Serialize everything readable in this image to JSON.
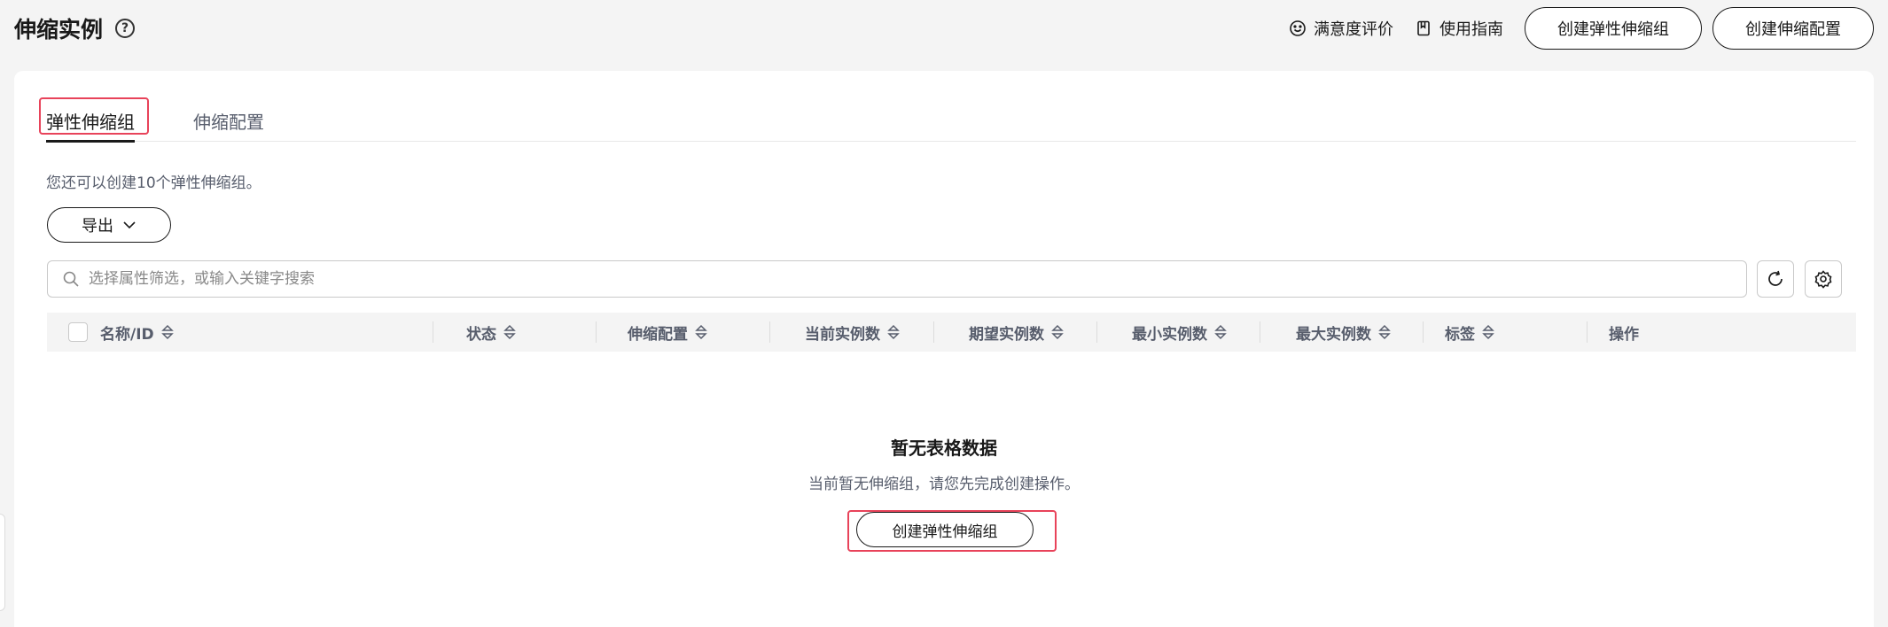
{
  "header": {
    "title": "伸缩实例",
    "help_icon": "question-circle-icon",
    "satisfaction_label": "满意度评价",
    "guide_label": "使用指南",
    "create_group_label": "创建弹性伸缩组",
    "create_config_label": "创建伸缩配置"
  },
  "tabs": [
    {
      "label": "弹性伸缩组",
      "active": true
    },
    {
      "label": "伸缩配置",
      "active": false
    }
  ],
  "quota_text": "您还可以创建10个弹性伸缩组。",
  "export_label": "导出",
  "search": {
    "placeholder": "选择属性筛选，或输入关键字搜索"
  },
  "table": {
    "columns": [
      "名称/ID",
      "状态",
      "伸缩配置",
      "当前实例数",
      "期望实例数",
      "最小实例数",
      "最大实例数",
      "标签",
      "操作"
    ]
  },
  "empty": {
    "title": "暂无表格数据",
    "description": "当前暂无伸缩组，请您先完成创建操作。",
    "button_label": "创建弹性伸缩组"
  },
  "colors": {
    "highlight": "#e8435a",
    "text_primary": "#191919",
    "text_secondary": "#575d6c"
  }
}
